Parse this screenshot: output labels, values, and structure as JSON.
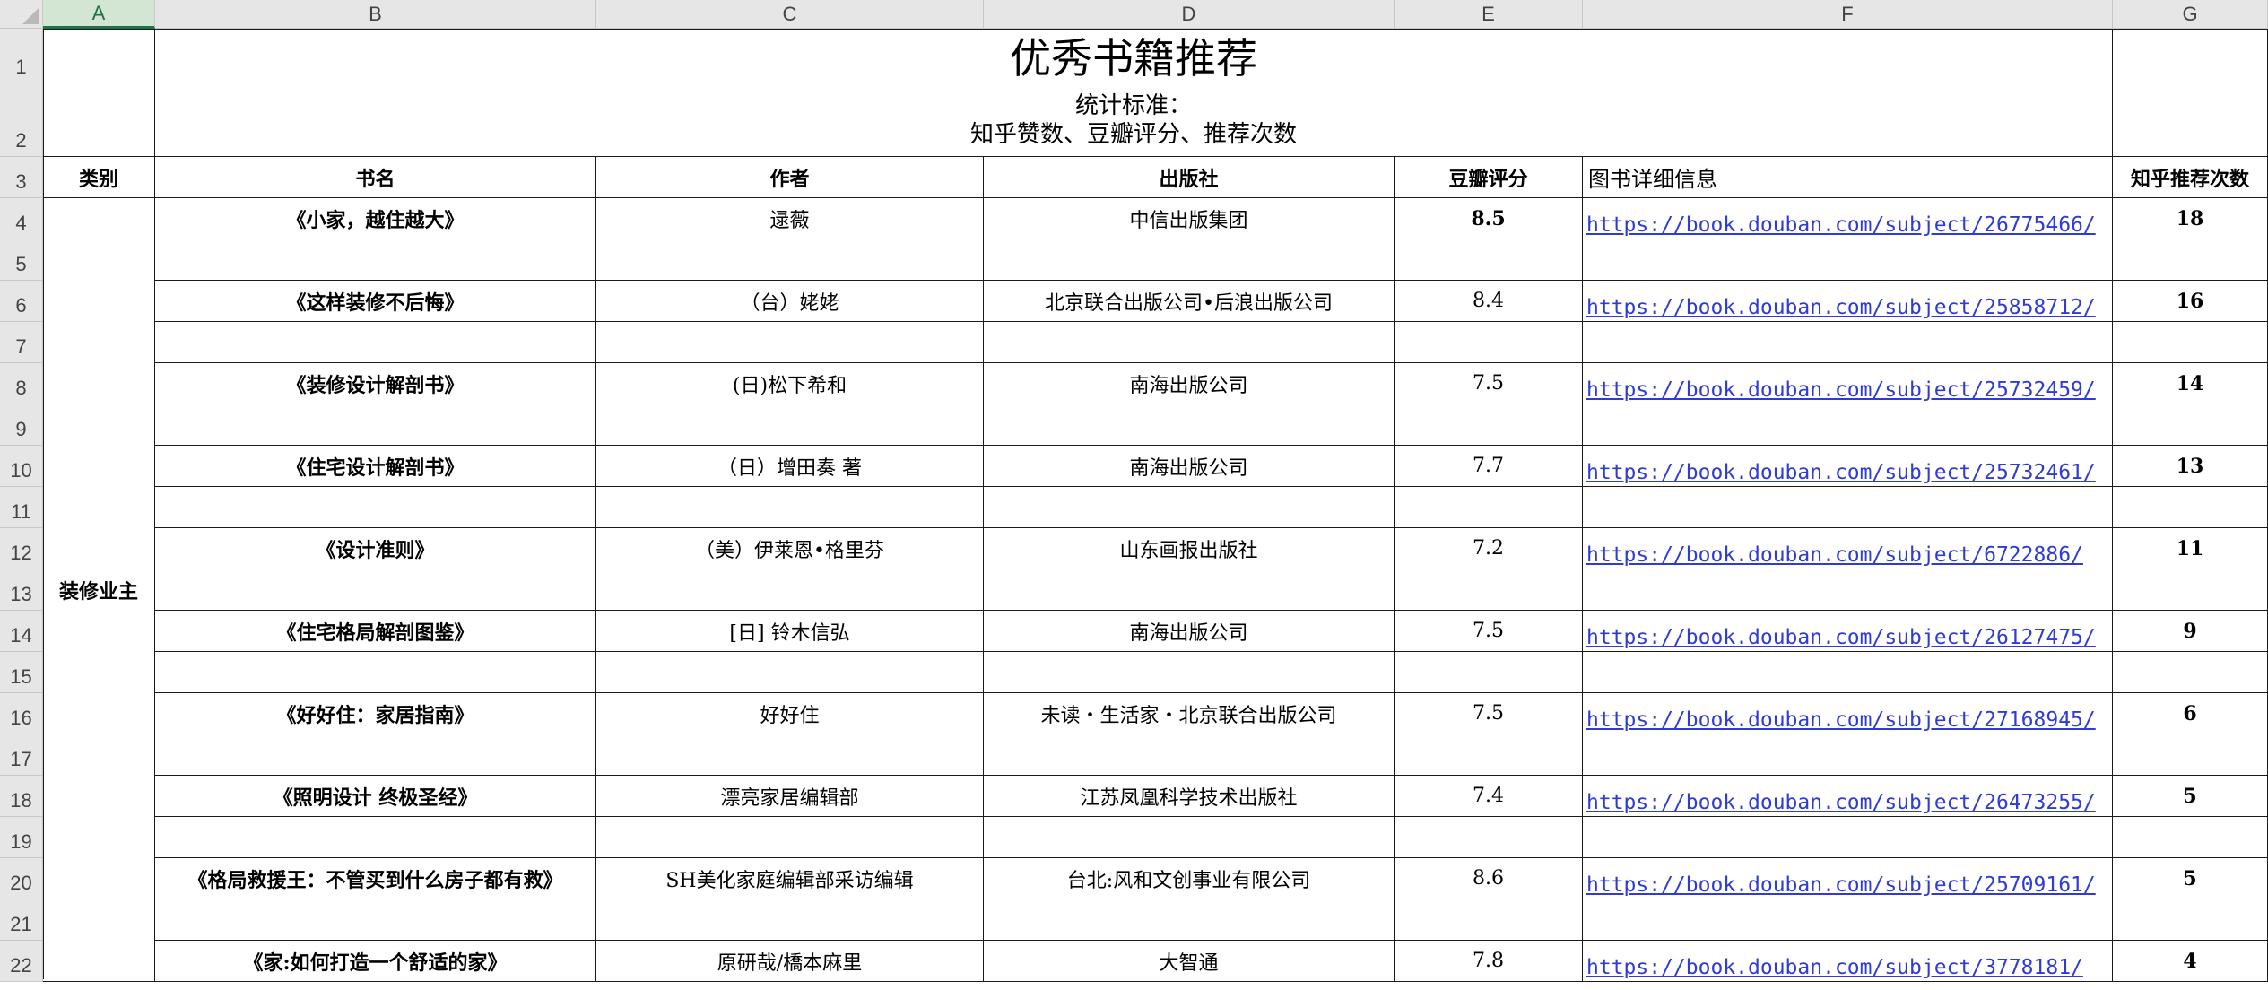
{
  "columns": [
    "A",
    "B",
    "C",
    "D",
    "E",
    "F",
    "G"
  ],
  "selected_column": "A",
  "rows": [
    "1",
    "2",
    "3",
    "4",
    "5",
    "6",
    "7",
    "8",
    "9",
    "10",
    "11",
    "12",
    "13",
    "14",
    "15",
    "16",
    "17",
    "18",
    "19",
    "20",
    "21",
    "22"
  ],
  "title": "优秀书籍推荐",
  "stats_line1": "统计标准：",
  "stats_line2": "知乎赞数、豆瓣评分、推荐次数",
  "headers": {
    "category": "类别",
    "name": "书名",
    "author": "作者",
    "publisher": "出版社",
    "rating": "豆瓣评分",
    "link": "图书详细信息",
    "count": "知乎推荐次数"
  },
  "category_value": "装修业主",
  "books": [
    {
      "name": "《小家，越住越大》",
      "author": "逯薇",
      "publisher": "中信出版集团",
      "rating": "8.5",
      "link": "https://book.douban.com/subject/26775466/",
      "count": "18"
    },
    {
      "name": "《这样装修不后悔》",
      "author": "（台）姥姥",
      "publisher": "北京联合出版公司•后浪出版公司",
      "rating": "8.4",
      "link": "https://book.douban.com/subject/25858712/",
      "count": "16"
    },
    {
      "name": "《装修设计解剖书》",
      "author": "(日)松下希和",
      "publisher": "南海出版公司",
      "rating": "7.5",
      "link": "https://book.douban.com/subject/25732459/",
      "count": "14"
    },
    {
      "name": "《住宅设计解剖书》",
      "author": "（日）增田奏  著",
      "publisher": "南海出版公司",
      "rating": "7.7",
      "link": "https://book.douban.com/subject/25732461/",
      "count": "13"
    },
    {
      "name": "《设计准则》",
      "author": "（美）伊莱恩•格里芬",
      "publisher": "山东画报出版社",
      "rating": "7.2",
      "link": "https://book.douban.com/subject/6722886/",
      "count": "11"
    },
    {
      "name": "《住宅格局解剖图鉴》",
      "author": "[日] 铃木信弘",
      "publisher": "南海出版公司",
      "rating": "7.5",
      "link": "https://book.douban.com/subject/26127475/",
      "count": "9"
    },
    {
      "name": "《好好住：家居指南》",
      "author": "好好住",
      "publisher": "未读・生活家・北京联合出版公司",
      "rating": "7.5",
      "link": "https://book.douban.com/subject/27168945/",
      "count": "6"
    },
    {
      "name": "《照明设计 终极圣经》",
      "author": "漂亮家居编辑部",
      "publisher": "江苏凤凰科学技术出版社",
      "rating": "7.4",
      "link": "https://book.douban.com/subject/26473255/",
      "count": "5"
    },
    {
      "name": "《格局救援王：不管买到什么房子都有救》",
      "author": "SH美化家庭编辑部采访编辑",
      "publisher": "台北:风和文创事业有限公司",
      "rating": "8.6",
      "link": "https://book.douban.com/subject/25709161/",
      "count": "5"
    },
    {
      "name": "《家:如何打造一个舒适的家》",
      "author": "原研哉/橋本麻里",
      "publisher": "大智通",
      "rating": "7.8",
      "link": "https://book.douban.com/subject/3778181/",
      "count": "4"
    }
  ]
}
